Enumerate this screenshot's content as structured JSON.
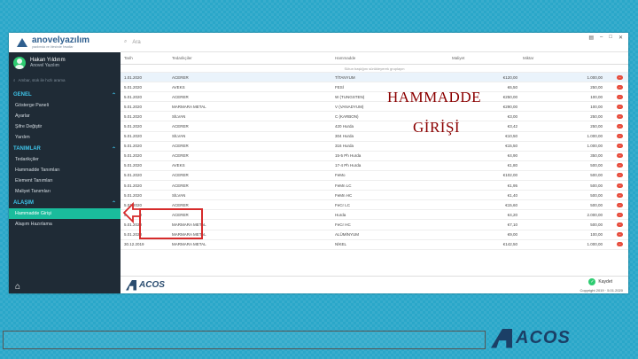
{
  "app": {
    "brand": "anovelyazılım",
    "brand_sub": "yazılımda ve ötesinde fırsatlar",
    "user_name": "Hakan Yıldırım",
    "user_role": "Anovel Yazılım",
    "side_search_placeholder": "Ambar, stok ile hızlı arama"
  },
  "sidebar": {
    "sections": [
      {
        "title": "GENEL",
        "items": [
          "Gösterge Paneli",
          "Ayarlar",
          "Şifre Değiştir",
          "Yardım"
        ]
      },
      {
        "title": "TANIMLAR",
        "items": [
          "Tedarikçiler",
          "Hammadde Tanımları",
          "Element Tanımları",
          "Maliyet Tanımları"
        ]
      },
      {
        "title": "ALAŞIM",
        "items": [
          "Hammadde Girişi",
          "Alaşım Hazırlama"
        ]
      }
    ],
    "active_item": "Hammadde Girişi"
  },
  "topbar": {
    "search_placeholder": "Ara"
  },
  "table": {
    "headers": [
      "Tarih",
      "Tedarikçiler",
      "",
      "Hammadde",
      "Maliyet",
      "Miktar",
      ""
    ],
    "group_hint": "Sütun başlığını sürükleyerek gruplayın",
    "rows": [
      [
        "1.01.2020",
        "ACERER",
        "TİTANYUM",
        "€120,00",
        "1.000,00"
      ],
      [
        "5.01.2020",
        "AVEKS",
        "FESİ",
        "€6,50",
        "250,00"
      ],
      [
        "5.01.2020",
        "ACERER",
        "W (TUNGSTEN)",
        "€250,00",
        "100,00"
      ],
      [
        "5.01.2020",
        "MARMARA METAL",
        "V (VANADYUM)",
        "€290,00",
        "100,00"
      ],
      [
        "5.01.2020",
        "SİLVAN",
        "C (KARBON)",
        "€3,00",
        "250,00"
      ],
      [
        "5.01.2020",
        "ACERER",
        "420 Hurda",
        "€3,42",
        "250,00"
      ],
      [
        "5.01.2020",
        "SİLVAN",
        "304 Hurda",
        "€10,50",
        "1.000,00"
      ],
      [
        "5.01.2020",
        "ACERER",
        "316 Hurda",
        "€15,50",
        "1.000,00"
      ],
      [
        "5.01.2020",
        "ACERER",
        "15-5 Ph Hurda",
        "€4,90",
        "350,00"
      ],
      [
        "5.01.2020",
        "AVEKS",
        "17-4 Ph Hurda",
        "€1,80",
        "500,00"
      ],
      [
        "5.01.2020",
        "ACERER",
        "FeMo",
        "€102,00",
        "500,00"
      ],
      [
        "5.01.2020",
        "ACERER",
        "FeMn LC",
        "€1,95",
        "500,00"
      ],
      [
        "5.01.2020",
        "SİLVAN",
        "FeMn HC",
        "€1,40",
        "500,00"
      ],
      [
        "5.01.2020",
        "ACERER",
        "FeCr LC",
        "€15,60",
        "500,00"
      ],
      [
        "5.01.2020",
        "ACERER",
        "Hurda",
        "€4,20",
        "2.000,00"
      ],
      [
        "5.01.2020",
        "MARMARA METAL",
        "FeCr HC",
        "€7,10",
        "500,00"
      ],
      [
        "5.01.2020",
        "MARMARA METAL",
        "ALÜMİNYUM",
        "€9,00",
        "100,00"
      ],
      [
        "30.12.2019",
        "MARMARA METAL",
        "NİKEL",
        "€142,50",
        "1.000,00"
      ]
    ]
  },
  "overlay": {
    "title_line1": "HAMMADDE",
    "title_line2": "GİRİŞİ"
  },
  "footer": {
    "logo_text": "ACOS",
    "save_label": "Kaydet",
    "copyright": "Copyright 2019 · 5.01.2020"
  },
  "bottom": {
    "logo_text": "ACOS"
  },
  "colors": {
    "sidebar_bg": "#1f2b36",
    "accent": "#1abc9c",
    "section": "#3ec3e8",
    "delete": "#e74c3c",
    "overlay_text": "#8b0000",
    "highlight_box": "#d62b2b",
    "background": "#2aa7c9"
  }
}
